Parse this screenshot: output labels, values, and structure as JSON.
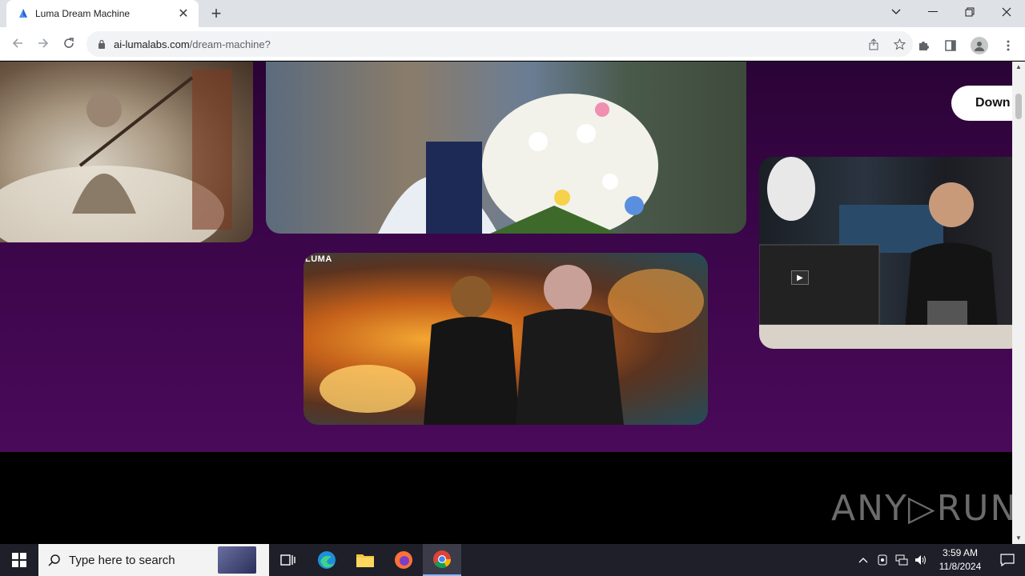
{
  "browser": {
    "tab_title": "Luma Dream Machine",
    "url_host": "ai-lumalabs.com",
    "url_path": "/dream-machine?"
  },
  "page": {
    "download_button": "Down",
    "card3_label": "LUMA",
    "watermark": "ANY▷RUN"
  },
  "taskbar": {
    "search_placeholder": "Type here to search",
    "time": "3:59 AM",
    "date": "11/8/2024"
  }
}
